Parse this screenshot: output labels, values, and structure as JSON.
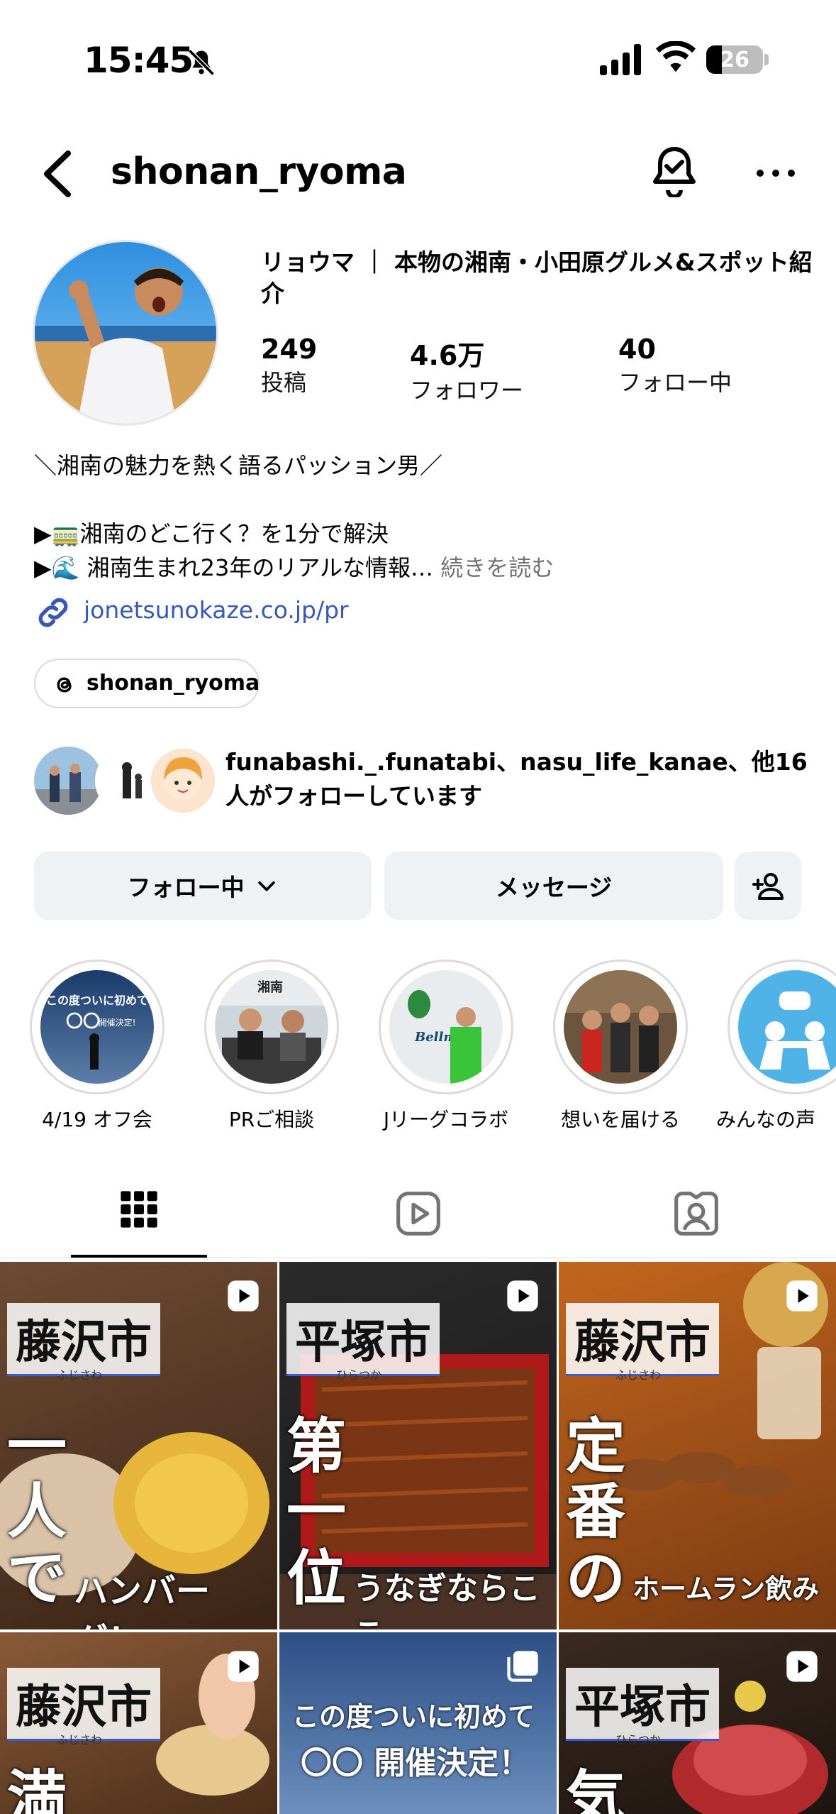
{
  "status_bar": {
    "time": "15:45",
    "battery": "26"
  },
  "header": {
    "username": "shonan_ryoma"
  },
  "profile": {
    "full_name": "リョウマ ｜ 本物の湘南・小田原グルメ&スポット紹介",
    "stats": [
      {
        "value": "249",
        "label": "投稿"
      },
      {
        "value": "4.6万",
        "label": "フォロワー"
      },
      {
        "value": "40",
        "label": "フォロー中"
      }
    ],
    "bio_line1": "＼湘南の魅力を熱く語るパッション男／",
    "bio_line2": "▶🚃湘南のどこ行く？を1分で解決",
    "bio_line3": "▶🌊 湘南生まれ23年のリアルな情報…",
    "bio_more": "続きを読む",
    "link": "jonetsunokaze.co.jp/pr",
    "threads_handle": "shonan_ryoma",
    "mutuals_text": "funabashi._.funatabi、nasu_life_kanae、他16人がフォローしています"
  },
  "actions": {
    "following": "フォロー中",
    "message": "メッセージ"
  },
  "highlights": [
    {
      "label": "4/19 オフ会"
    },
    {
      "label": "PRご相談"
    },
    {
      "label": "Jリーグコラボ"
    },
    {
      "label": "想いを届ける"
    },
    {
      "label": "みんなの声"
    }
  ],
  "posts": [
    {
      "city": "藤沢市",
      "reading": "ふじさわ",
      "big": "一人",
      "big2": "で",
      "small": "ハンバーグ！"
    },
    {
      "city": "平塚市",
      "reading": "ひらつか",
      "big": "第一",
      "big2": "位",
      "small": "うなぎならここ"
    },
    {
      "city": "藤沢市",
      "reading": "ふじさわ",
      "big": "定番",
      "big2": "の",
      "small": "ホームラン飲み"
    },
    {
      "city": "藤沢市",
      "reading": "ふじさわ",
      "big": "満"
    },
    {
      "line1": "この度ついに初めて",
      "line2": "〇〇 開催決定！"
    },
    {
      "city": "平塚市",
      "reading": "ひらつか",
      "big": "気"
    }
  ],
  "colors": {
    "link": "#3858b8",
    "button_bg": "#eff2f5",
    "accent": "#3b5bd0"
  }
}
